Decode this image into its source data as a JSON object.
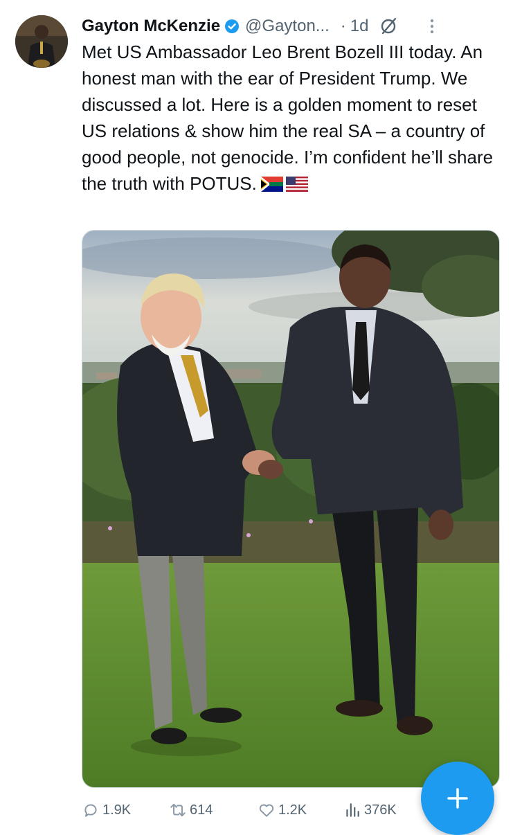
{
  "author": {
    "name": "Gayton McKenzie",
    "handle": "@Gayton...",
    "separator": "·",
    "time": "1d",
    "verified": true,
    "avatar_icon": "avatar-photo"
  },
  "tweet": {
    "text": "Met US Ambassador Leo Brent Bozell III today. An honest man with the ear of President Trump. We discussed a lot. Here is a golden moment to reset US relations & show him the real SA – a country of good people, not genocide. I’m confident he’ll share the truth with POTUS.",
    "flags": [
      "south-africa-flag",
      "us-flag"
    ]
  },
  "media": {
    "icon": "photo-handshake"
  },
  "actions": {
    "replies": "1.9K",
    "retweets": "614",
    "likes": "1.2K",
    "views": "376K"
  },
  "colors": {
    "accent": "#1d9bf0",
    "text": "#0f1419",
    "muted": "#536471"
  }
}
